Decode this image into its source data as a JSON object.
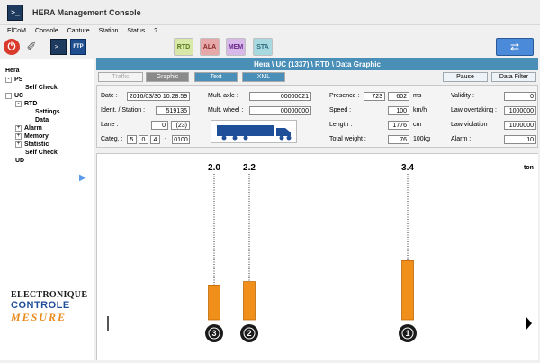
{
  "app": {
    "title": "HERA Management Console",
    "icon": "console-prompt-icon"
  },
  "menu": [
    "ElCoM",
    "Console",
    "Capture",
    "Station",
    "Status",
    "?"
  ],
  "toolbar": {
    "power_icon": "power-icon",
    "probe_icon": "probe-icon",
    "console_label": ">_",
    "ftp_label": "FTP",
    "modules": [
      "RTD",
      "ALA",
      "MEM",
      "STA"
    ],
    "refresh_icon": "refresh-icon"
  },
  "sidebar": {
    "items": [
      {
        "label": "Hera",
        "toggle": ""
      },
      {
        "label": "PS",
        "toggle": "-"
      },
      {
        "label": "Self Check",
        "toggle": ""
      },
      {
        "label": "UC",
        "toggle": "-"
      },
      {
        "label": "RTD",
        "toggle": "-"
      },
      {
        "label": "Settings",
        "toggle": ""
      },
      {
        "label": "Data",
        "toggle": ""
      },
      {
        "label": "Alarm",
        "toggle": "+"
      },
      {
        "label": "Memory",
        "toggle": "+"
      },
      {
        "label": "Statistic",
        "toggle": "+"
      },
      {
        "label": "Self Check",
        "toggle": ""
      },
      {
        "label": "UD",
        "toggle": ""
      }
    ],
    "logo": {
      "line1": "ELECTRONIQUE",
      "line2": "CONTROLE",
      "line3": "MESURE"
    }
  },
  "header": {
    "breadcrumb": "Hera \\ UC  (1337)  \\ RTD \\ Data Graphic"
  },
  "tabs": {
    "traffic": "Traffic",
    "graphic": "Graphic",
    "text": "Text",
    "xml": "XML"
  },
  "buttons": {
    "pause": "Pause",
    "data_filter": "Data Filter"
  },
  "info": {
    "date_label": "Date :",
    "date_value": "2016/03/30 10:28:59",
    "ident_label": "Ident. / Station :",
    "ident_value": "519135",
    "lane_label": "Lane :",
    "lane_value": "0",
    "lane_code": "(23)",
    "categ_label": "Categ. :",
    "categ_values": [
      "5",
      "0",
      "4"
    ],
    "categ_sep": "-",
    "categ_code": "0100",
    "mult_axle_label": "Mult. axle :",
    "mult_axle_value": "00000021",
    "mult_wheel_label": "Mult. wheel :",
    "mult_wheel_value": "00000000",
    "presence_label": "Presence :",
    "presence_value1": "723",
    "presence_value2": "602",
    "presence_unit": "ms",
    "speed_label": "Speed :",
    "speed_value": "100",
    "speed_unit": "km/h",
    "length_label": "Length :",
    "length_value": "1776",
    "length_unit": "cm",
    "weight_label": "Total weight :",
    "weight_value": "76",
    "weight_unit": "100kg",
    "validity_label": "Validity :",
    "validity_value": "0",
    "law_overtaking_label": "Law overtaking :",
    "law_overtaking_value": "1000000",
    "law_violation_label": "Law violation :",
    "law_violation_value": "1000000",
    "alarm_label": "Alarm :",
    "alarm_value": "10",
    "truck_icon": "truck-icon"
  },
  "chart_data": {
    "type": "bar",
    "unit_label": "ton",
    "axles": [
      {
        "number": "3",
        "value": 2.0,
        "label": "2.0"
      },
      {
        "number": "2",
        "value": 2.2,
        "label": "2.2"
      },
      {
        "number": "1",
        "value": 3.4,
        "label": "3.4"
      }
    ],
    "bar_color": "#f0901a",
    "ylim": [
      0,
      8.5
    ]
  },
  "colors": {
    "accent": "#4a8fb8",
    "bar": "#f0901a"
  }
}
